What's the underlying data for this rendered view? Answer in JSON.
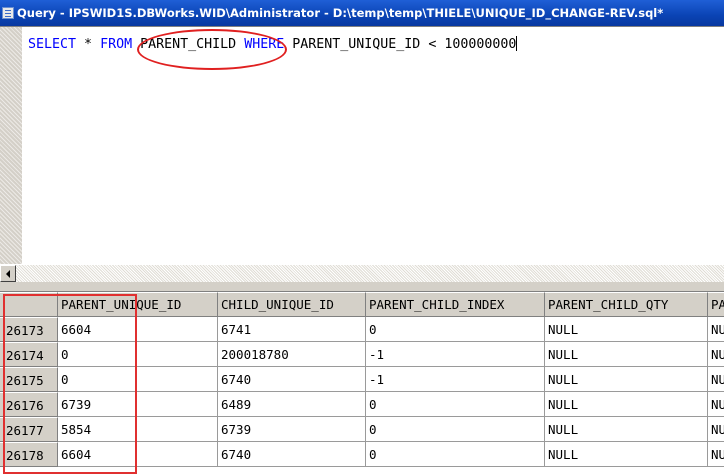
{
  "window": {
    "title": "Query - IPSWID1S.DBWorks.WID\\Administrator - D:\\temp\\temp\\THIELE\\UNIQUE_ID_CHANGE-REV.sql*",
    "icon": "query-document-icon"
  },
  "editor": {
    "kw_select": "SELECT",
    "part_star": " * ",
    "kw_from": "FROM",
    "part_table": " PARENT_CHILD ",
    "kw_where": "WHERE",
    "part_condition": " PARENT_UNIQUE_ID < 100000000"
  },
  "scrollbar": {
    "left_arrow_icon": "arrow-left-icon"
  },
  "results": {
    "columns": [
      "PARENT_UNIQUE_ID",
      "CHILD_UNIQUE_ID",
      "PARENT_CHILD_INDEX",
      "PARENT_CHILD_QTY",
      "PA"
    ],
    "rows": [
      {
        "row_num": "26173",
        "cells": [
          "6604",
          "6741",
          "0",
          "NULL",
          "NU"
        ]
      },
      {
        "row_num": "26174",
        "cells": [
          "0",
          "200018780",
          "-1",
          "NULL",
          "NU"
        ]
      },
      {
        "row_num": "26175",
        "cells": [
          "0",
          "6740",
          "-1",
          "NULL",
          "NU"
        ]
      },
      {
        "row_num": "26176",
        "cells": [
          "6739",
          "6489",
          "0",
          "NULL",
          "NU"
        ]
      },
      {
        "row_num": "26177",
        "cells": [
          "5854",
          "6739",
          "0",
          "NULL",
          "NU"
        ]
      },
      {
        "row_num": "26178",
        "cells": [
          "6604",
          "6740",
          "0",
          "NULL",
          "NU"
        ]
      }
    ]
  },
  "colors": {
    "titlebar": "#0a43b4",
    "keyword": "#0000ff",
    "annotation": "#e02020"
  }
}
